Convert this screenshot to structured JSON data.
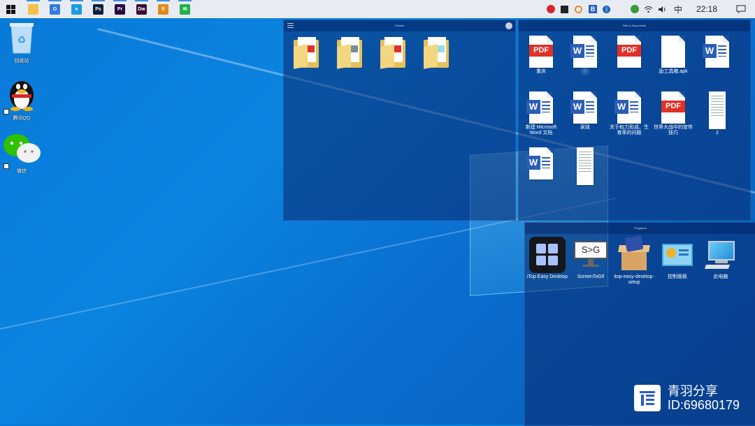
{
  "taskbar": {
    "clock": "22:18",
    "input_method": "中",
    "pinned": [
      {
        "name": "file-explorer",
        "color": "#f4c24a",
        "glyph": ""
      },
      {
        "name": "app-o",
        "color": "#2f7de1",
        "glyph": "O"
      },
      {
        "name": "edge",
        "color": "#1d9ae0",
        "glyph": "e"
      },
      {
        "name": "photoshop",
        "color": "#0b1f3a",
        "glyph": "Ps"
      },
      {
        "name": "premiere",
        "color": "#2a0a3f",
        "glyph": "Pr"
      },
      {
        "name": "dreamweaver",
        "color": "#3a0a2f",
        "glyph": "Dw"
      },
      {
        "name": "search-tool",
        "color": "#e08a1d",
        "glyph": "⚲"
      },
      {
        "name": "wechat",
        "color": "#21b14c",
        "glyph": "✉"
      }
    ]
  },
  "desktop": {
    "icons": [
      {
        "label": "回收站",
        "icon": "recycle-bin-icon"
      },
      {
        "label": "腾讯QQ",
        "icon": "qq-penguin-icon"
      },
      {
        "label": "微信",
        "icon": "wechat-icon"
      }
    ]
  },
  "fences": {
    "folders": {
      "title": "Folders",
      "items": [
        {
          "label": "",
          "type": "folder-pdf"
        },
        {
          "label": "",
          "type": "folder-photo"
        },
        {
          "label": "",
          "type": "folder-pdf"
        },
        {
          "label": "",
          "type": "folder-doc"
        }
      ]
    },
    "files": {
      "title": "Files & Documents",
      "items": [
        {
          "label": "重庆",
          "type": "pdf"
        },
        {
          "label": "麻",
          "type": "word",
          "blurred": true
        },
        {
          "label": "",
          "type": "pdf",
          "blurred": true
        },
        {
          "label": "逅工具箱.apk",
          "type": "blank"
        },
        {
          "label": "",
          "type": "word",
          "blurred": true
        },
        {
          "label": "新建 Microsoft Word 文档",
          "type": "word"
        },
        {
          "label": "家政",
          "type": "word"
        },
        {
          "label": "关于权力形成、生育率的问题",
          "type": "word"
        },
        {
          "label": "世界大战中的宣传技巧",
          "type": "pdf"
        },
        {
          "label": "2",
          "type": "thumb"
        },
        {
          "label": "",
          "type": "word",
          "blurred": true
        },
        {
          "label": "",
          "type": "thumb"
        }
      ]
    },
    "programs": {
      "title": "Programs",
      "items": [
        {
          "label": "iTop Easy Desktop",
          "icon": "itop-easy-desktop-icon"
        },
        {
          "label": "ScreenToGif",
          "icon": "screentogif-icon",
          "icon_text": "S>G"
        },
        {
          "label": "itop-easy-desktop-setup",
          "icon": "setup-box-icon"
        },
        {
          "label": "控制面板",
          "icon": "control-panel-icon"
        },
        {
          "label": "此电脑",
          "icon": "this-pc-icon"
        }
      ]
    }
  },
  "watermark": {
    "line1": "青羽分享",
    "line2": "ID:69680179"
  },
  "colors": {
    "pdf": "#e03127",
    "word": "#2b5eb4",
    "folder": "#e7c05a"
  }
}
